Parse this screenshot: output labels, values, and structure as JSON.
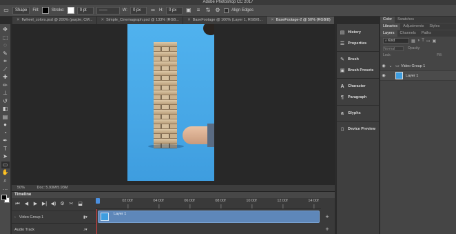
{
  "app": {
    "title": "Adobe Photoshop CC 2017"
  },
  "options_bar": {
    "shape_mode": "Shape",
    "fill_label": "Fill:",
    "stroke_label": "Stroke:",
    "stroke_width": "0 pt",
    "w_label": "W:",
    "w_value": "0 px",
    "h_label": "H:",
    "h_value": "0 px",
    "align_edges_label": "Align Edges"
  },
  "document_tabs": [
    {
      "label": "flwheel_colors.psd @ 200% (purple, CM...",
      "active": false
    },
    {
      "label": "Simple_Cinemagraph.psd @ 133% (RGB...",
      "active": false
    },
    {
      "label": "BaseFootage @ 100% (Layer 1, RGB/8...",
      "active": false
    },
    {
      "label": "BaseFootage-2 @ 50% (RGB/8)",
      "active": true
    }
  ],
  "status_bar": {
    "zoom": "50%",
    "doc_info": "Doc: 5.93M/5.93M"
  },
  "timeline": {
    "title": "Timeline",
    "ticks": [
      "",
      "02:00f",
      "04:00f",
      "06:00f",
      "08:00f",
      "10:00f",
      "12:00f",
      "14:00f"
    ],
    "tracks": [
      {
        "label": "Video Group 1"
      },
      {
        "label": "Audio Track"
      }
    ],
    "clip_label": "Layer 1"
  },
  "dock": {
    "group1": [
      {
        "label": "History",
        "icon": "history-icon"
      },
      {
        "label": "Properties",
        "icon": "properties-icon"
      }
    ],
    "group2": [
      {
        "label": "Brush",
        "icon": "brush-icon"
      },
      {
        "label": "Brush Presets",
        "icon": "brush-presets-icon"
      }
    ],
    "group3": [
      {
        "label": "Character",
        "icon": "character-icon"
      },
      {
        "label": "Paragraph",
        "icon": "paragraph-icon"
      }
    ],
    "group4": [
      {
        "label": "Glyphs",
        "icon": "glyphs-icon"
      }
    ],
    "group5": [
      {
        "label": "Device Preview",
        "icon": "device-preview-icon"
      }
    ]
  },
  "right_panel": {
    "top_tabs": [
      "Color",
      "Swatches"
    ],
    "mid_tabs": [
      "Libraries",
      "Adjustments",
      "Styles"
    ],
    "layer_tabs": [
      "Layers",
      "Channels",
      "Paths"
    ],
    "kind_label": "Kind",
    "blend_mode": "Normal",
    "opacity_label": "Opacity:",
    "lock_label": "Lock:",
    "fill_label": "Fill:",
    "layers": [
      {
        "name": "Video Group 1"
      },
      {
        "name": "Layer 1"
      }
    ]
  }
}
